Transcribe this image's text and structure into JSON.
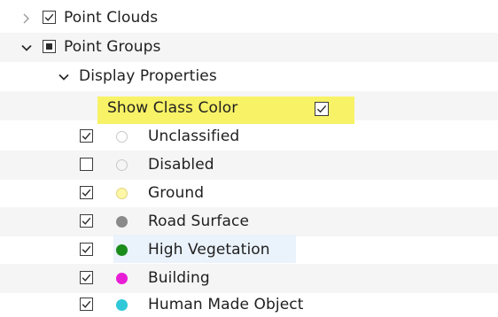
{
  "tree": {
    "point_clouds": {
      "label": "Point Clouds",
      "checked": true,
      "expanded": false
    },
    "point_groups": {
      "label": "Point Groups",
      "checked": "partial",
      "expanded": true
    },
    "display_properties": {
      "label": "Display Properties",
      "expanded": true
    },
    "show_class_color": {
      "label": "Show Class Color",
      "checked": true,
      "highlight_color": "#f7f266"
    },
    "classes": [
      {
        "label": "Unclassified",
        "checked": true,
        "color": "#ffffff"
      },
      {
        "label": "Disabled",
        "checked": false,
        "color": "#ffffff"
      },
      {
        "label": "Ground",
        "checked": true,
        "color": "#fff7a8"
      },
      {
        "label": "Road Surface",
        "checked": true,
        "color": "#8a8a8a"
      },
      {
        "label": "High Vegetation",
        "checked": true,
        "color": "#1a8c1a"
      },
      {
        "label": "Building",
        "checked": true,
        "color": "#e81ed6"
      },
      {
        "label": "Human Made Object",
        "checked": true,
        "color": "#2ec8d8"
      }
    ]
  },
  "icons": {
    "collapsed": "chevron-right-icon",
    "expanded": "chevron-down-icon"
  }
}
